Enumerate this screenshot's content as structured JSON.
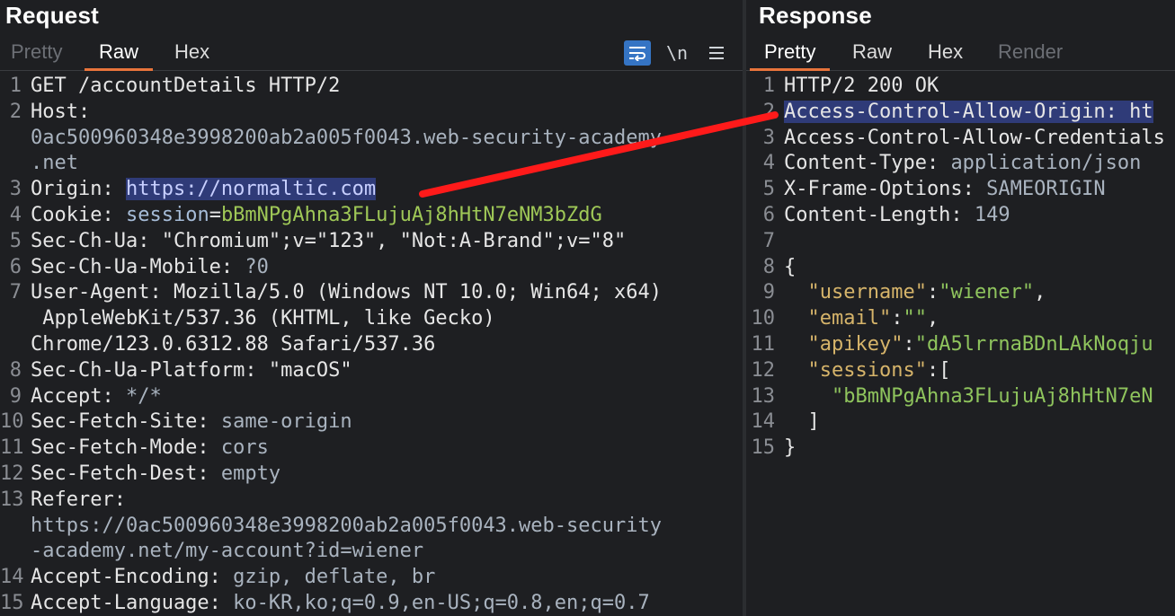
{
  "request": {
    "title": "Request",
    "tabs": [
      "Pretty",
      "Raw",
      "Hex"
    ],
    "toolbar": {
      "wrap_icon": "wrap-lines-icon",
      "newline_label": "\\n",
      "menu_icon": "hamburger-menu-icon"
    },
    "lines": [
      {
        "n": "1",
        "parts": [
          {
            "t": "GET /accountDetails HTTP/2",
            "c": "k"
          }
        ]
      },
      {
        "n": "2",
        "parts": [
          {
            "t": "Host:",
            "c": "k"
          }
        ]
      },
      {
        "n": "",
        "parts": [
          {
            "t": "0ac500960348e3998200ab2a005f0043.web-security-academy",
            "c": "v"
          }
        ]
      },
      {
        "n": "",
        "parts": [
          {
            "t": ".net",
            "c": "v"
          }
        ]
      },
      {
        "n": "3",
        "parts": [
          {
            "t": "Origin: ",
            "c": "k"
          },
          {
            "t": "https://normaltic.com",
            "c": "hl"
          }
        ]
      },
      {
        "n": "4",
        "parts": [
          {
            "t": "Cookie: ",
            "c": "k"
          },
          {
            "t": "session",
            "c": "cname"
          },
          {
            "t": "=",
            "c": "k"
          },
          {
            "t": "bBmNPgAhna3FLujuAj8hHtN7eNM3bZdG",
            "c": "cval"
          }
        ]
      },
      {
        "n": "5",
        "parts": [
          {
            "t": "Sec-Ch-Ua: ",
            "c": "k"
          },
          {
            "t": "\"Chromium\";v=\"123\", \"Not:A-Brand\";v=\"8\"",
            "c": "k"
          }
        ]
      },
      {
        "n": "6",
        "parts": [
          {
            "t": "Sec-Ch-Ua-Mobile: ",
            "c": "k"
          },
          {
            "t": "?0",
            "c": "v"
          }
        ]
      },
      {
        "n": "7",
        "parts": [
          {
            "t": "User-Agent: ",
            "c": "k"
          },
          {
            "t": "Mozilla/5.0 (Windows NT 10.0; Win64; x64)",
            "c": "k"
          }
        ]
      },
      {
        "n": "",
        "parts": [
          {
            "t": " AppleWebKit/537.36 (KHTML, like Gecko)",
            "c": "k"
          }
        ]
      },
      {
        "n": "",
        "parts": [
          {
            "t": "Chrome/123.0.6312.88 Safari/537.36",
            "c": "k"
          }
        ]
      },
      {
        "n": "8",
        "parts": [
          {
            "t": "Sec-Ch-Ua-Platform: ",
            "c": "k"
          },
          {
            "t": "\"macOS\"",
            "c": "k"
          }
        ]
      },
      {
        "n": "9",
        "parts": [
          {
            "t": "Accept: ",
            "c": "k"
          },
          {
            "t": "*/*",
            "c": "v"
          }
        ]
      },
      {
        "n": "10",
        "parts": [
          {
            "t": "Sec-Fetch-Site: ",
            "c": "k"
          },
          {
            "t": "same-origin",
            "c": "v"
          }
        ]
      },
      {
        "n": "11",
        "parts": [
          {
            "t": "Sec-Fetch-Mode: ",
            "c": "k"
          },
          {
            "t": "cors",
            "c": "v"
          }
        ]
      },
      {
        "n": "12",
        "parts": [
          {
            "t": "Sec-Fetch-Dest: ",
            "c": "k"
          },
          {
            "t": "empty",
            "c": "v"
          }
        ]
      },
      {
        "n": "13",
        "parts": [
          {
            "t": "Referer:",
            "c": "k"
          }
        ]
      },
      {
        "n": "",
        "parts": [
          {
            "t": "https://0ac500960348e3998200ab2a005f0043.web-security",
            "c": "v"
          }
        ]
      },
      {
        "n": "",
        "parts": [
          {
            "t": "-academy.net/my-account?id=wiener",
            "c": "v"
          }
        ]
      },
      {
        "n": "14",
        "parts": [
          {
            "t": "Accept-Encoding: ",
            "c": "k"
          },
          {
            "t": "gzip, deflate, br",
            "c": "v"
          }
        ]
      },
      {
        "n": "15",
        "parts": [
          {
            "t": "Accept-Language: ",
            "c": "k"
          },
          {
            "t": "ko-KR,ko;q=0.9,en-US;q=0.8,en;q=0.7",
            "c": "v"
          }
        ]
      }
    ]
  },
  "response": {
    "title": "Response",
    "tabs": [
      "Pretty",
      "Raw",
      "Hex",
      "Render"
    ],
    "lines": [
      {
        "n": "1",
        "parts": [
          {
            "t": "HTTP/2 200 OK",
            "c": "k"
          }
        ]
      },
      {
        "n": "2",
        "parts": [
          {
            "t": "Access-Control-Allow-Origin: ht",
            "c": "hlk"
          }
        ]
      },
      {
        "n": "3",
        "parts": [
          {
            "t": "Access-Control-Allow-Credentials",
            "c": "k"
          }
        ]
      },
      {
        "n": "4",
        "parts": [
          {
            "t": "Content-Type: ",
            "c": "k"
          },
          {
            "t": "application/json",
            "c": "v"
          }
        ]
      },
      {
        "n": "5",
        "parts": [
          {
            "t": "X-Frame-Options: ",
            "c": "k"
          },
          {
            "t": "SAMEORIGIN",
            "c": "v"
          }
        ]
      },
      {
        "n": "6",
        "parts": [
          {
            "t": "Content-Length: ",
            "c": "k"
          },
          {
            "t": "149",
            "c": "v"
          }
        ]
      },
      {
        "n": "7",
        "parts": []
      },
      {
        "n": "8",
        "parts": [
          {
            "t": "{",
            "c": "jp"
          }
        ]
      },
      {
        "n": "9",
        "parts": [
          {
            "t": "  ",
            "c": "jp"
          },
          {
            "t": "\"username\"",
            "c": "jk"
          },
          {
            "t": ":",
            "c": "jp"
          },
          {
            "t": "\"wiener\"",
            "c": "js"
          },
          {
            "t": ",",
            "c": "jp"
          }
        ]
      },
      {
        "n": "10",
        "parts": [
          {
            "t": "  ",
            "c": "jp"
          },
          {
            "t": "\"email\"",
            "c": "jk"
          },
          {
            "t": ":",
            "c": "jp"
          },
          {
            "t": "\"\"",
            "c": "js"
          },
          {
            "t": ",",
            "c": "jp"
          }
        ]
      },
      {
        "n": "11",
        "parts": [
          {
            "t": "  ",
            "c": "jp"
          },
          {
            "t": "\"apikey\"",
            "c": "jk"
          },
          {
            "t": ":",
            "c": "jp"
          },
          {
            "t": "\"dA5lrrnaBDnLAkNoqju",
            "c": "js"
          }
        ]
      },
      {
        "n": "12",
        "parts": [
          {
            "t": "  ",
            "c": "jp"
          },
          {
            "t": "\"sessions\"",
            "c": "jk"
          },
          {
            "t": ":[",
            "c": "jp"
          }
        ]
      },
      {
        "n": "13",
        "parts": [
          {
            "t": "    ",
            "c": "jp"
          },
          {
            "t": "\"bBmNPgAhna3FLujuAj8hHtN7eN",
            "c": "js"
          }
        ]
      },
      {
        "n": "14",
        "parts": [
          {
            "t": "  ]",
            "c": "jp"
          }
        ]
      },
      {
        "n": "15",
        "parts": [
          {
            "t": "}",
            "c": "jp"
          }
        ]
      }
    ]
  },
  "annotation": {
    "arrow_color": "#ff1a1a"
  }
}
